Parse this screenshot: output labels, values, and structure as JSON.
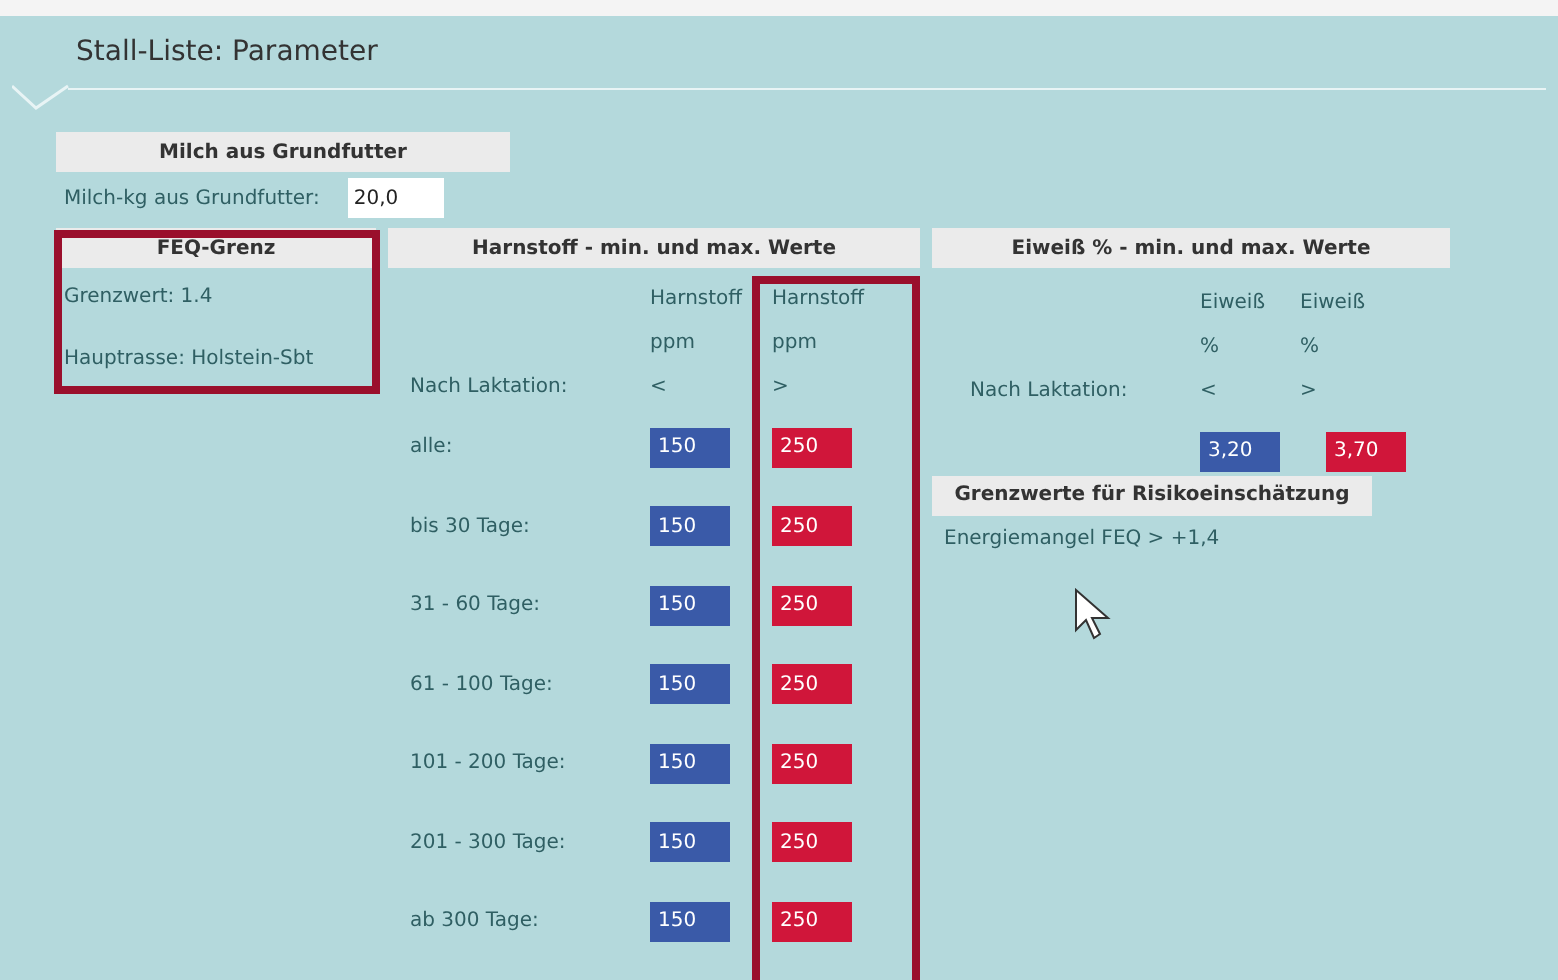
{
  "title": "Stall-Liste: Parameter",
  "milk": {
    "header": "Milch aus Grundfutter",
    "label": "Milch-kg aus Grundfutter:",
    "value": "20,0"
  },
  "feq": {
    "header": "FEQ-Grenz",
    "lines": [
      "Grenzwert: 1.4",
      "Hauptrasse: Holstein-Sbt"
    ]
  },
  "harnstoff": {
    "header": "Harnstoff - min. und max. Werte",
    "row_head": "Nach Laktation:",
    "col_heads": [
      [
        "Harnstoff",
        "ppm",
        "<"
      ],
      [
        "Harnstoff",
        "ppm",
        ">"
      ]
    ],
    "rows": [
      {
        "label": "alle:",
        "min": "150",
        "max": "250"
      },
      {
        "label": "bis 30 Tage:",
        "min": "150",
        "max": "250"
      },
      {
        "label": "31 - 60 Tage:",
        "min": "150",
        "max": "250"
      },
      {
        "label": "61 - 100 Tage:",
        "min": "150",
        "max": "250"
      },
      {
        "label": "101 - 200 Tage:",
        "min": "150",
        "max": "250"
      },
      {
        "label": "201 - 300 Tage:",
        "min": "150",
        "max": "250"
      },
      {
        "label": "ab 300 Tage:",
        "min": "150",
        "max": "250"
      }
    ]
  },
  "eiweiss": {
    "header": "Eiweiß % - min. und max. Werte",
    "row_head": "Nach Laktation:",
    "col_heads": [
      [
        "Eiweiß",
        "%",
        "<"
      ],
      [
        "Eiweiß",
        "%",
        ">"
      ]
    ],
    "min": "3,20",
    "max": "3,70"
  },
  "risk": {
    "header": "Grenzwerte für Risikoeinschätzung",
    "text": "Energiemangel FEQ > +1,4"
  }
}
